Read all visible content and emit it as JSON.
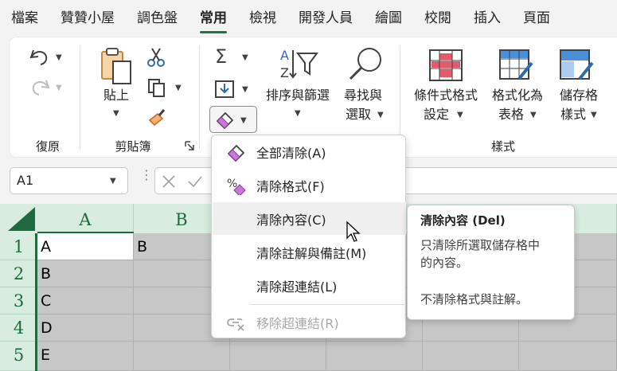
{
  "tabs": [
    {
      "label": "檔案"
    },
    {
      "label": "贊贊小屋"
    },
    {
      "label": "調色盤"
    },
    {
      "label": "常用"
    },
    {
      "label": "檢視"
    },
    {
      "label": "開發人員"
    },
    {
      "label": "繪圖"
    },
    {
      "label": "校閱"
    },
    {
      "label": "插入"
    },
    {
      "label": "頁面"
    }
  ],
  "ribbon": {
    "undo_group": "復原",
    "clipboard_group": "剪貼簿",
    "paste_label": "貼上",
    "sort_filter_label": "排序與篩選",
    "find_select_line1": "尋找與",
    "find_select_line2": "選取",
    "cond_format_line1": "條件式格式",
    "cond_format_line2": "設定",
    "format_table_line1": "格式化為",
    "format_table_line2": "表格",
    "cell_styles_line1": "儲存格",
    "cell_styles_line2": "樣式",
    "styles_group": "樣式"
  },
  "namebox": {
    "value": "A1"
  },
  "columns": [
    "A",
    "B"
  ],
  "rows": [
    "1",
    "2",
    "3",
    "4",
    "5"
  ],
  "cells": {
    "A1": "A",
    "B1": "B",
    "A2": "B",
    "A3": "C",
    "A4": "D",
    "A5": "E"
  },
  "menu": {
    "items": [
      {
        "label": "全部清除(A)"
      },
      {
        "label": "清除格式(F)"
      },
      {
        "label": "清除內容(C)"
      },
      {
        "label": "清除註解與備註(M)"
      },
      {
        "label": "清除超連結(L)"
      },
      {
        "label": "移除超連結(R)"
      }
    ]
  },
  "tooltip": {
    "title": "清除內容 (Del)",
    "line1": "只清除所選取儲存格中",
    "line2": "的內容。",
    "line3": "不清除格式與註解。"
  },
  "colors": {
    "accent": "#217346",
    "header_bg": "#d9ece0"
  }
}
